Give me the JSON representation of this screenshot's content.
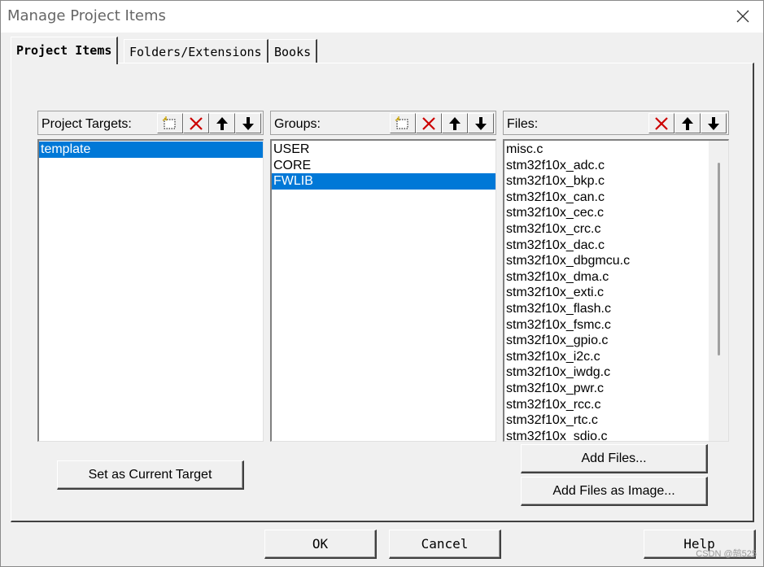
{
  "window": {
    "title": "Manage Project Items"
  },
  "tabs": [
    {
      "label": "Project Items",
      "active": true
    },
    {
      "label": "Folders/Extensions",
      "active": false
    },
    {
      "label": "Books",
      "active": false
    }
  ],
  "targets": {
    "label": "Project Targets:",
    "items": [
      "template"
    ],
    "selected": 0
  },
  "groups": {
    "label": "Groups:",
    "items": [
      "USER",
      "CORE",
      "FWLIB"
    ],
    "selected": 2
  },
  "files": {
    "label": "Files:",
    "items": [
      "misc.c",
      "stm32f10x_adc.c",
      "stm32f10x_bkp.c",
      "stm32f10x_can.c",
      "stm32f10x_cec.c",
      "stm32f10x_crc.c",
      "stm32f10x_dac.c",
      "stm32f10x_dbgmcu.c",
      "stm32f10x_dma.c",
      "stm32f10x_exti.c",
      "stm32f10x_flash.c",
      "stm32f10x_fsmc.c",
      "stm32f10x_gpio.c",
      "stm32f10x_i2c.c",
      "stm32f10x_iwdg.c",
      "stm32f10x_pwr.c",
      "stm32f10x_rcc.c",
      "stm32f10x_rtc.c",
      "stm32f10x_sdio.c"
    ]
  },
  "buttons": {
    "set_current_target": "Set as Current Target",
    "add_files": "Add Files...",
    "add_files_image": "Add Files as Image...",
    "ok": "OK",
    "cancel": "Cancel",
    "help": "Help"
  },
  "watermark": "CSDN @鹄525",
  "colors": {
    "selection": "#0078d7",
    "delete": "#cc0000"
  },
  "icons": [
    "close-icon",
    "new-item-icon",
    "delete-icon",
    "move-up-icon",
    "move-down-icon"
  ]
}
